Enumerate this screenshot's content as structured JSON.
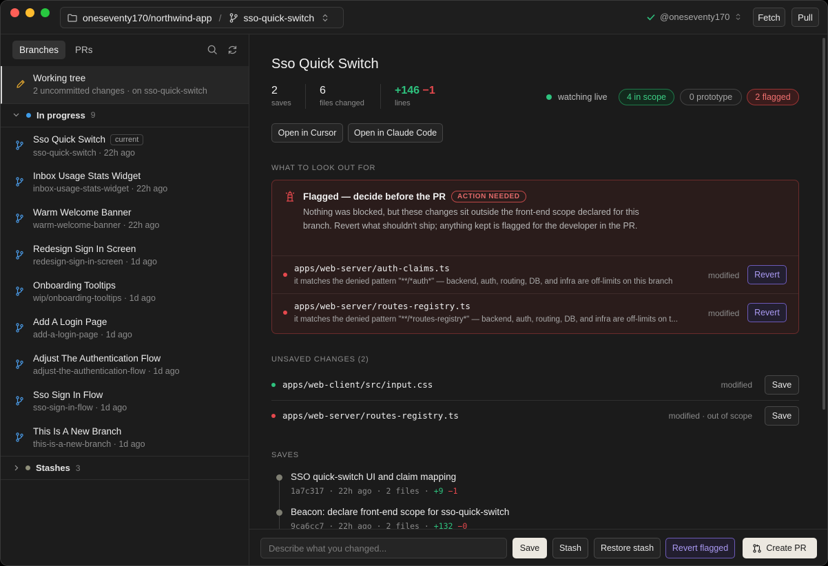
{
  "titlebar": {
    "repo": "oneseventy170/northwind-app",
    "separator": "/",
    "branch": "sso-quick-switch",
    "user": "@oneseventy170",
    "fetch_label": "Fetch",
    "pull_label": "Pull"
  },
  "sidebar": {
    "tabs": [
      {
        "label": "Branches",
        "active": true
      },
      {
        "label": "PRs",
        "active": false
      }
    ],
    "working_tree": {
      "title": "Working tree",
      "subtitle": "2 uncommitted changes · on sso-quick-switch"
    },
    "in_progress": {
      "label": "In progress",
      "count": "9",
      "dot_color": "#3f9ce8"
    },
    "branches": [
      {
        "title": "Sso Quick Switch",
        "badge": "current",
        "subtitle": "sso-quick-switch · 22h ago"
      },
      {
        "title": "Inbox Usage Stats Widget",
        "subtitle": "inbox-usage-stats-widget · 22h ago"
      },
      {
        "title": "Warm Welcome Banner",
        "subtitle": "warm-welcome-banner · 22h ago"
      },
      {
        "title": "Redesign Sign In Screen",
        "subtitle": "redesign-sign-in-screen · 1d ago"
      },
      {
        "title": "Onboarding Tooltips",
        "subtitle": "wip/onboarding-tooltips · 1d ago"
      },
      {
        "title": "Add A Login Page",
        "subtitle": "add-a-login-page · 1d ago"
      },
      {
        "title": "Adjust The Authentication Flow",
        "subtitle": "adjust-the-authentication-flow · 1d ago"
      },
      {
        "title": "Sso Sign In Flow",
        "subtitle": "sso-sign-in-flow · 1d ago"
      },
      {
        "title": "This Is A New Branch",
        "subtitle": "this-is-a-new-branch · 1d ago"
      }
    ],
    "stashes": {
      "label": "Stashes",
      "count": "3"
    }
  },
  "main": {
    "title": "Sso Quick Switch",
    "stats": {
      "saves_num": "2",
      "saves_label": "saves",
      "files_num": "6",
      "files_label": "files changed",
      "lines_added": "+146",
      "lines_removed": "−1",
      "lines_label": "lines"
    },
    "status": {
      "live": "watching live",
      "in_scope": "4 in scope",
      "prototype": "0 prototype",
      "flagged": "2 flagged"
    },
    "open_cursor": "Open in Cursor",
    "open_claude": "Open in Claude Code",
    "lookout_label": "WHAT TO LOOK OUT FOR",
    "flagged": {
      "title": "Flagged — decide before the PR",
      "badge": "ACTION NEEDED",
      "description": "Nothing was blocked, but these changes sit outside the front-end scope declared for this branch. Revert what shouldn't ship; anything kept is flagged for the developer in the PR.",
      "files": [
        {
          "path": "apps/web-server/auth-claims.ts",
          "reason": "it matches the denied pattern \"**/*auth*\" — backend, auth, routing, DB, and infra are off-limits on this branch",
          "status": "modified",
          "action": "Revert"
        },
        {
          "path": "apps/web-server/routes-registry.ts",
          "reason": "it matches the denied pattern \"**/*routes-registry*\" — backend, auth, routing, DB, and infra are off-limits on t...",
          "status": "modified",
          "action": "Revert"
        }
      ]
    },
    "unsaved": {
      "label": "UNSAVED CHANGES (2)",
      "files": [
        {
          "path": "apps/web-client/src/input.css",
          "status": "modified",
          "action": "Save",
          "dot": "#2ec27e"
        },
        {
          "path": "apps/web-server/routes-registry.ts",
          "status": "modified · out of scope",
          "action": "Save",
          "dot": "#e5484d"
        }
      ]
    },
    "saves": {
      "label": "SAVES",
      "commits": [
        {
          "title": "SSO quick-switch UI and claim mapping",
          "hash": "1a7c317",
          "age": "22h ago",
          "files": "2 files",
          "added": "+9",
          "removed": "−1"
        },
        {
          "title": "Beacon: declare front-end scope for sso-quick-switch",
          "hash": "9ca6cc7",
          "age": "22h ago",
          "files": "2 files",
          "added": "+132",
          "removed": "−0"
        }
      ]
    }
  },
  "footer": {
    "placeholder": "Describe what you changed...",
    "save": "Save",
    "stash": "Stash",
    "restore": "Restore stash",
    "revert_flagged": "Revert flagged",
    "create_pr": "Create PR"
  },
  "colors": {
    "accent_green": "#2ec27e",
    "accent_red": "#e5484d",
    "accent_purple": "#8f7ce8",
    "branch_icon": "#4a9be8"
  }
}
